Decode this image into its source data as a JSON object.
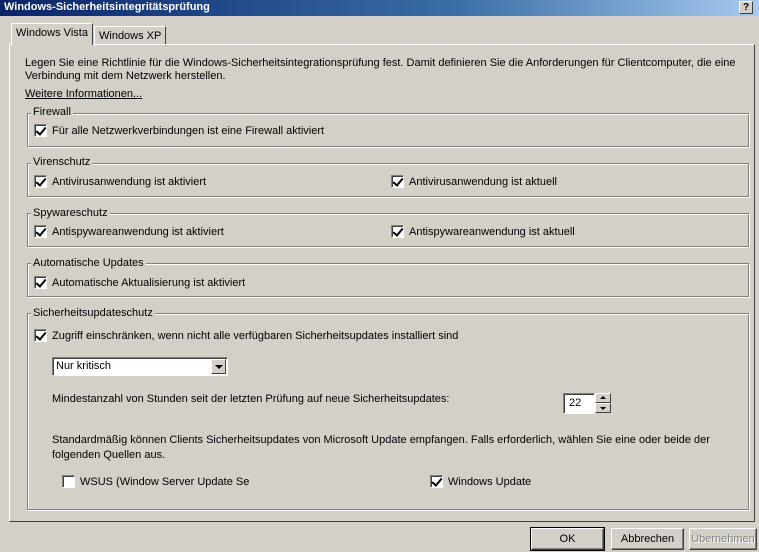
{
  "window": {
    "title": "Windows-Sicherheitsintegritätsprüfung",
    "help_label": "?"
  },
  "tabs": [
    {
      "label": "Windows Vista",
      "active": true
    },
    {
      "label": "Windows XP",
      "active": false
    }
  ],
  "intro": {
    "line1": "Legen Sie eine Richtlinie für die Windows-Sicherheitsintegrationsprüfung fest. Damit definieren Sie die Anforderungen für Clientcomputer, die eine",
    "line2": "Verbindung mit dem Netzwerk herstellen.",
    "more_info": "Weitere Informationen..."
  },
  "firewall": {
    "legend": "Firewall",
    "all_connections": {
      "label": "Für alle Netzwerkverbindungen ist eine Firewall aktiviert",
      "checked": true
    }
  },
  "antivirus": {
    "legend": "Virenschutz",
    "enabled": {
      "label": "Antivirusanwendung ist aktiviert",
      "checked": true
    },
    "up_to_date": {
      "label": "Antivirusanwendung ist aktuell",
      "checked": true
    }
  },
  "antispyware": {
    "legend": "Spywareschutz",
    "enabled": {
      "label": "Antispywareanwendung ist aktiviert",
      "checked": true
    },
    "up_to_date": {
      "label": "Antispywareanwendung ist aktuell",
      "checked": true
    }
  },
  "auto_updates": {
    "legend": "Automatische Updates",
    "enabled": {
      "label": "Automatische Aktualisierung ist aktiviert",
      "checked": true
    }
  },
  "security_updates": {
    "legend": "Sicherheitsupdateschutz",
    "restrict": {
      "label": "Zugriff einschränken, wenn nicht alle verfügbaren Sicherheitsupdates installiert sind",
      "checked": true
    },
    "severity_selected": "Nur kritisch",
    "min_hours_label": "Mindestanzahl von Stunden seit der letzten Prüfung auf neue Sicherheitsupdates:",
    "min_hours_value": "22",
    "sources_line1": "Standardmäßig können Clients Sicherheitsupdates von Microsoft Update empfangen. Falls erforderlich, wählen Sie eine oder beide der",
    "sources_line2": "folgenden Quellen aus.",
    "wsus": {
      "label": "WSUS (Window Server Update Se",
      "checked": false
    },
    "windows_update": {
      "label": "Windows Update",
      "checked": true
    }
  },
  "buttons": {
    "ok": "OK",
    "cancel": "Abbrechen",
    "apply": "Übernehmen"
  }
}
